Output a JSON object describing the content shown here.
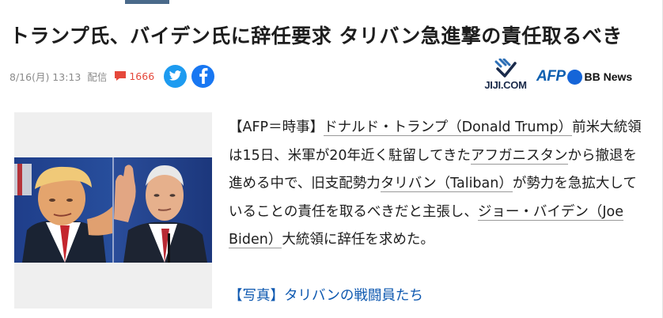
{
  "headline": "トランプ氏、バイデン氏に辞任要求 タリバン急進撃の責任取るべき",
  "meta": {
    "date": "8/16(月) 13:13",
    "published": "配信",
    "comment_count": "1666",
    "share": [
      "twitter-icon",
      "facebook-icon"
    ]
  },
  "sources": {
    "jiji": "JIJI.COM",
    "afp": "AFP",
    "bb": "BB News"
  },
  "article": {
    "s1": "【AFP＝時事】",
    "l1": "ドナルド・トランプ（Donald Trump）",
    "s2": "前米大統領は15日、米軍が20年近く駐留してきた",
    "l2": "アフガニスタン",
    "s3": "から撤退を進める中で、旧支配勢力",
    "l3": "タリバン（Taliban）",
    "s4": "が勢力を急拡大していることの責任を取るべきだと主張し、",
    "l4": "ジョー・バイデン（Joe Biden）",
    "s5": "大統領に辞任を求めた。"
  },
  "photo_link": "【写真】タリバンの戦闘員たち",
  "colors": {
    "comment": "#e5483b",
    "twitter": "#1d9bf0",
    "facebook": "#1877f2",
    "afp": "#0d5fb0",
    "link": "#0d58b0"
  }
}
